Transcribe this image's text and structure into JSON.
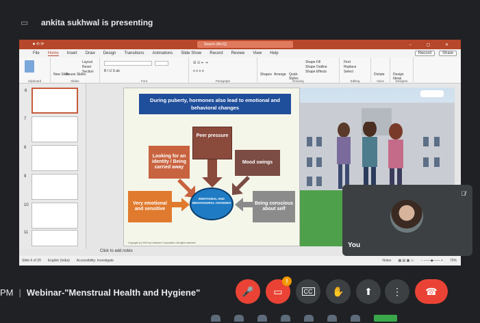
{
  "meet": {
    "presenting_text": "ankita sukhwal is presenting",
    "time_fragment": "PM",
    "meeting_title": "Webinar-\"Menstrual Health and Hygiene\"",
    "self_label": "You",
    "notification_count": "!"
  },
  "ppt": {
    "search_placeholder": "Search (Alt+Q)",
    "tabs": [
      "File",
      "Home",
      "Insert",
      "Draw",
      "Design",
      "Transitions",
      "Animations",
      "Slide Show",
      "Record",
      "Review",
      "View",
      "Help"
    ],
    "record_btn": "Record",
    "share_btn": "Share",
    "ribbon_groups": [
      "Clipboard",
      "Slides",
      "Font",
      "Paragraph",
      "Drawing",
      "Editing",
      "Voice",
      "Designer"
    ],
    "ribbon_items": {
      "new_slide": "New Slide",
      "reuse_slides": "Reuse Slides",
      "layout": "Layout",
      "reset": "Reset",
      "section": "Section",
      "shapes": "Shapes",
      "arrange": "Arrange",
      "quick_styles": "Quick Styles",
      "shape_fill": "Shape Fill",
      "shape_outline": "Shape Outline",
      "shape_effects": "Shape Effects",
      "find": "Find",
      "replace": "Replace",
      "select": "Select",
      "dictate": "Dictate",
      "design_ideas": "Design Ideas"
    },
    "thumbnails": [
      "6",
      "7",
      "8",
      "9",
      "10",
      "11"
    ],
    "notes_placeholder": "Click to add notes",
    "status": {
      "slide_info": "Slide 6 of 29",
      "language": "English (India)",
      "accessibility": "Accessibility: Investigate",
      "notes": "Notes",
      "zoom": "70%"
    }
  },
  "slide": {
    "title": "During puberty, hormones also lead to emotional and behavioral changes",
    "center": "EMOTIONAL AND BEHAVIOURAL CHANGES",
    "peer": "Peer pressure",
    "identity": "Looking for an identity / Being carried away",
    "mood": "Mood swings",
    "emotional": "Very emotional and sensitive",
    "conscious": "Being conscious about self",
    "copyright": "Copyright (c) 2019 by Unicharm Corporation. All rights reserved."
  },
  "colors": {
    "ppt_accent": "#b7472a",
    "slide_title_bg": "#1f4e9a",
    "center_circle": "#1f7bc4",
    "end_call": "#ea4335"
  }
}
